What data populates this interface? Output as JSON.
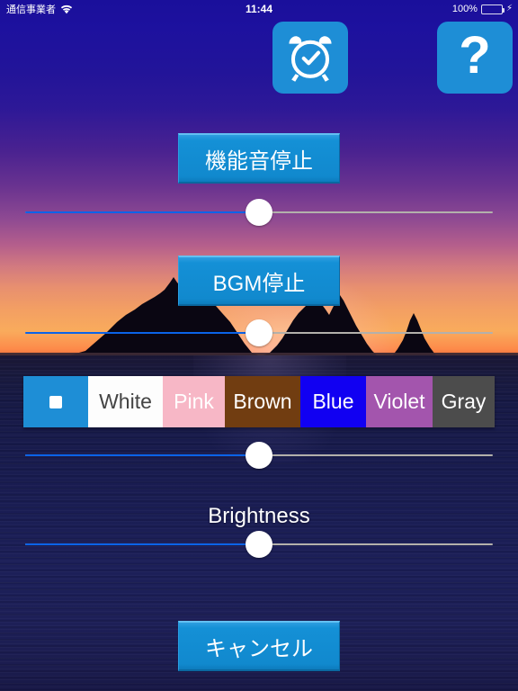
{
  "status_bar": {
    "carrier": "通信事業者",
    "wifi_icon": "wifi-icon",
    "time": "11:44",
    "battery_percent": "100%",
    "battery_level": 100,
    "charging_icon": "lightning-bolt-icon"
  },
  "top_buttons": [
    {
      "name": "alarm-button",
      "icon": "alarm-clock-icon",
      "label": ""
    },
    {
      "name": "help-button",
      "icon": "question-mark-icon",
      "label": "?"
    }
  ],
  "controls": {
    "sound_effect_button": "機能音停止",
    "bgm_button": "BGM停止",
    "cancel_button": "キャンセル",
    "brightness_label": "Brightness"
  },
  "sliders": [
    {
      "name": "sound-effect-volume-slider",
      "value": 50
    },
    {
      "name": "bgm-volume-slider",
      "value": 50
    },
    {
      "name": "color-slider",
      "value": 50
    },
    {
      "name": "brightness-slider",
      "value": 50
    }
  ],
  "color_segments": [
    {
      "label": "",
      "icon": "selected-square-icon",
      "bg": "#1e8ed6",
      "fg": "#ffffff",
      "width": 72,
      "selected": true
    },
    {
      "label": "White",
      "icon": "",
      "bg": "#fdfdfd",
      "fg": "#444444",
      "width": 83,
      "selected": false
    },
    {
      "label": "Pink",
      "icon": "",
      "bg": "#f7b7c6",
      "fg": "#ffffff",
      "width": 69,
      "selected": false
    },
    {
      "label": "Brown",
      "icon": "",
      "bg": "#713d11",
      "fg": "#ffffff",
      "width": 84,
      "selected": false
    },
    {
      "label": "Blue",
      "icon": "",
      "bg": "#1100f2",
      "fg": "#ffffff",
      "width": 73,
      "selected": false
    },
    {
      "label": "Violet",
      "icon": "",
      "bg": "#a355ad",
      "fg": "#ffffff",
      "width": 74,
      "selected": false
    },
    {
      "label": "Gray",
      "icon": "",
      "bg": "#4c4c4c",
      "fg": "#ffffff",
      "width": 69,
      "selected": false
    }
  ],
  "theme": {
    "button_blue": "#1490d6",
    "slider_fill": "#0b63e8",
    "slider_track": "#b3b0ab",
    "status_text": "#ffffff"
  },
  "background": {
    "scene": "sunset-seascape-photo",
    "sky_top": "#1a0f9b",
    "horizon": "#f9ab5c",
    "water": "#1a1d53"
  }
}
